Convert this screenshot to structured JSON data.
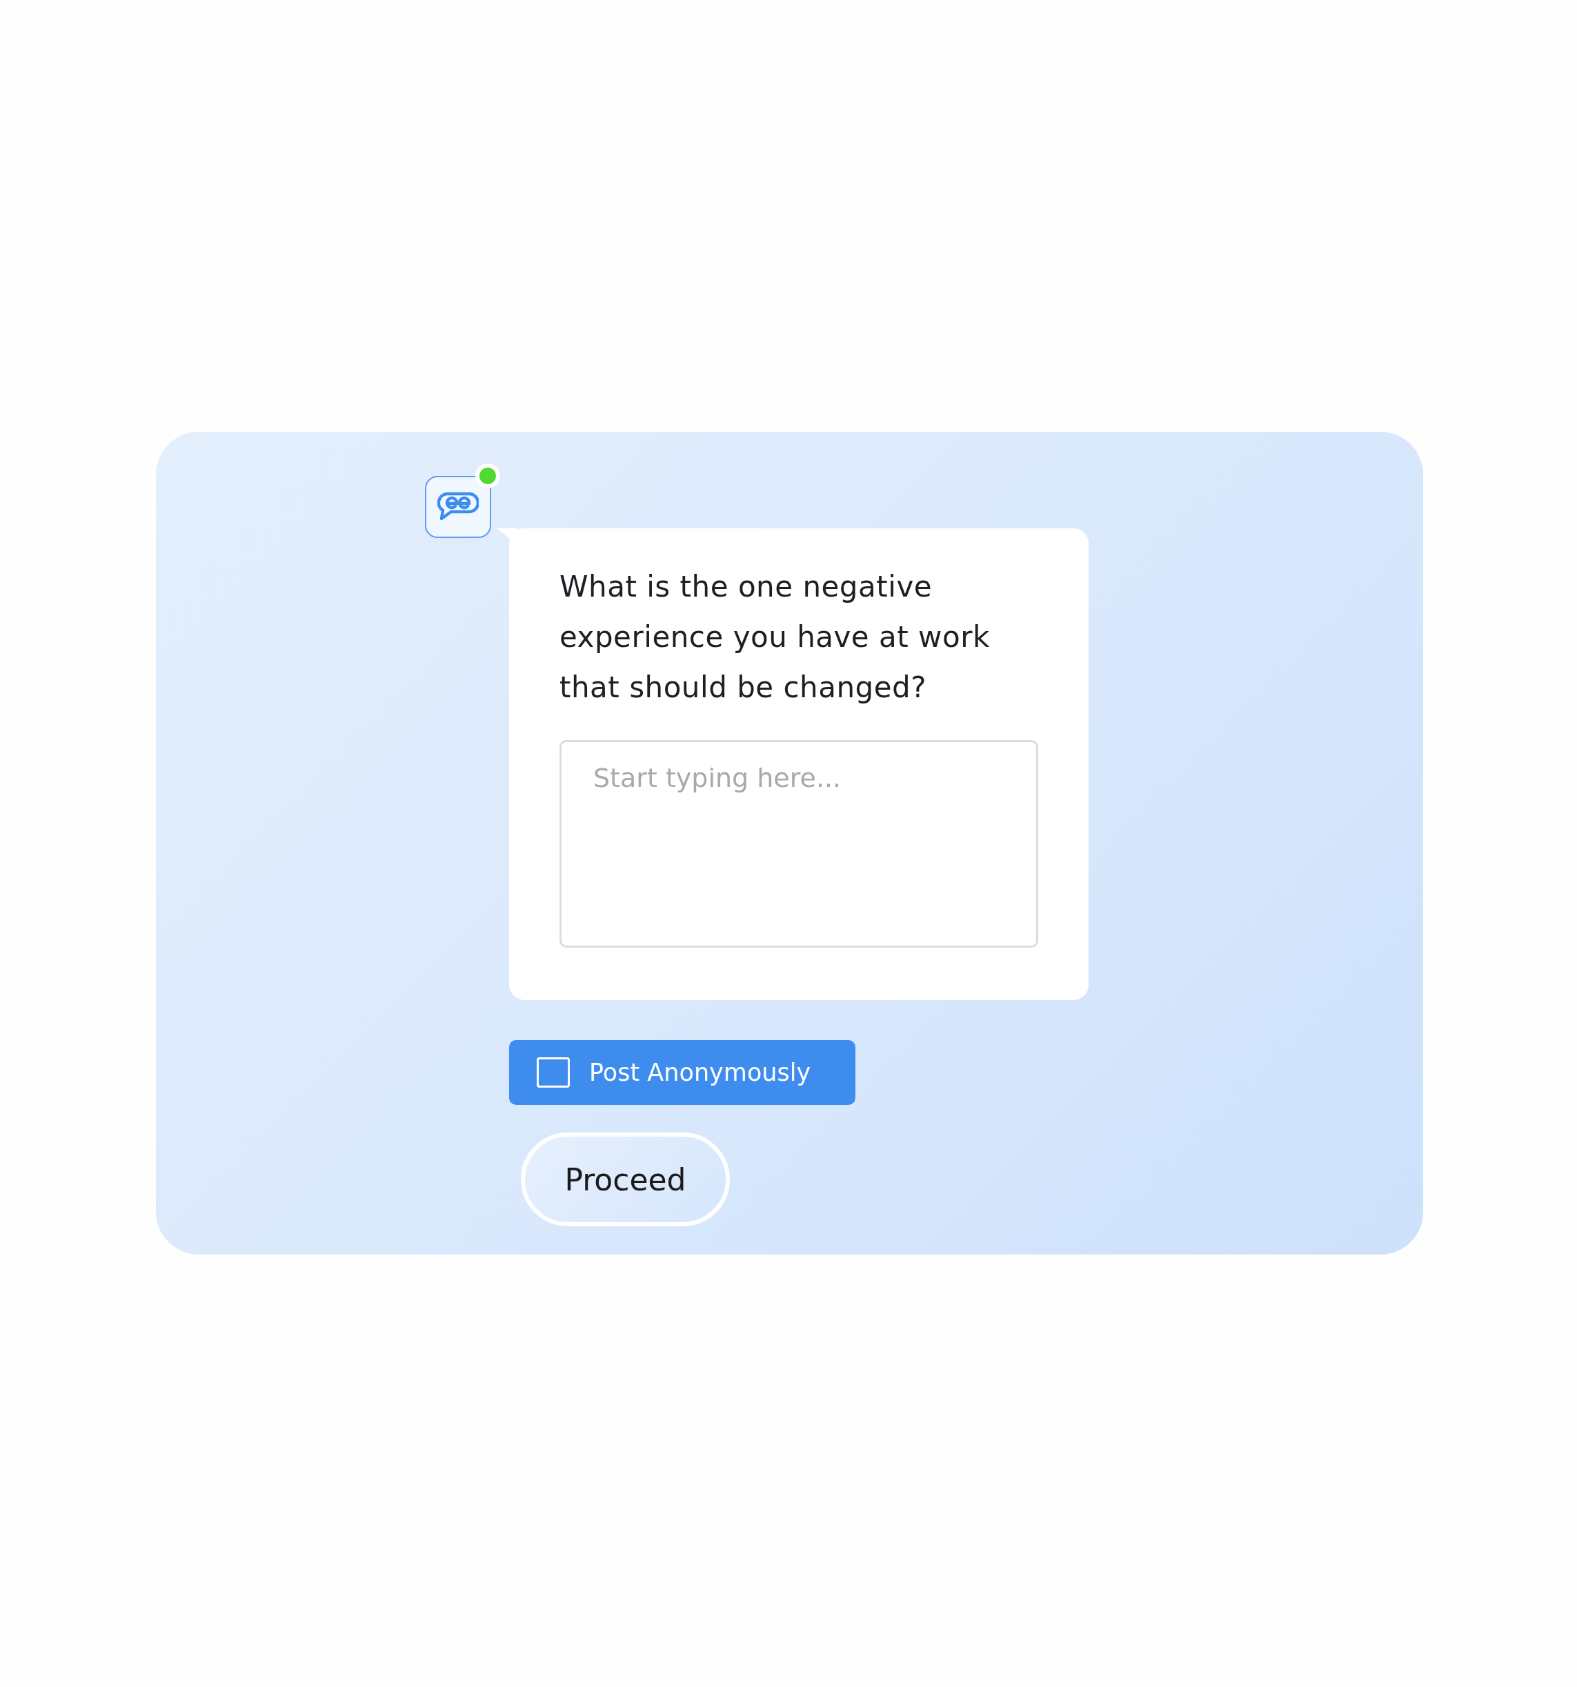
{
  "assistant": {
    "online": true
  },
  "question": "What is the one negative experience you have at work that should be changed?",
  "answer": {
    "placeholder": "Start typing here..."
  },
  "anonymous": {
    "label": "Post Anonymously",
    "checked": false
  },
  "proceed_button": {
    "label": "Proceed"
  }
}
